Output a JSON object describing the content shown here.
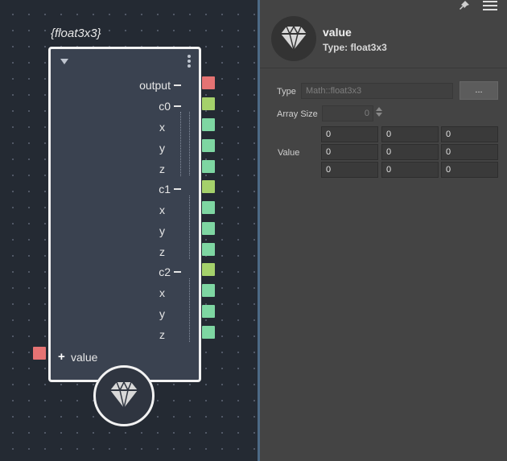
{
  "node": {
    "title": "{float3x3}",
    "ports": [
      {
        "label": "output",
        "kind": "output"
      },
      {
        "label": "c0",
        "kind": "compound"
      },
      {
        "label": "x",
        "kind": "scalar"
      },
      {
        "label": "y",
        "kind": "scalar"
      },
      {
        "label": "z",
        "kind": "scalar"
      },
      {
        "label": "c1",
        "kind": "compound"
      },
      {
        "label": "x",
        "kind": "scalar"
      },
      {
        "label": "y",
        "kind": "scalar"
      },
      {
        "label": "z",
        "kind": "scalar"
      },
      {
        "label": "c2",
        "kind": "compound"
      },
      {
        "label": "x",
        "kind": "scalar"
      },
      {
        "label": "y",
        "kind": "scalar"
      },
      {
        "label": "z",
        "kind": "scalar"
      }
    ],
    "input": {
      "plus": "+",
      "label": "value"
    },
    "icon": "diamond-icon"
  },
  "panel": {
    "name": "value",
    "type_text": "Type: float3x3",
    "type_label": "Type",
    "type_value": "Math::float3x3",
    "browse_button": "...",
    "array_size_label": "Array Size",
    "array_size_value": "0",
    "value_label": "Value",
    "matrix": [
      [
        "0",
        "0",
        "0"
      ],
      [
        "0",
        "0",
        "0"
      ],
      [
        "0",
        "0",
        "0"
      ]
    ]
  },
  "colors": {
    "output_port": "#e57373",
    "compound_port": "#a5d16b",
    "scalar_port": "#7ed6a2",
    "input_port": "#e57373"
  }
}
